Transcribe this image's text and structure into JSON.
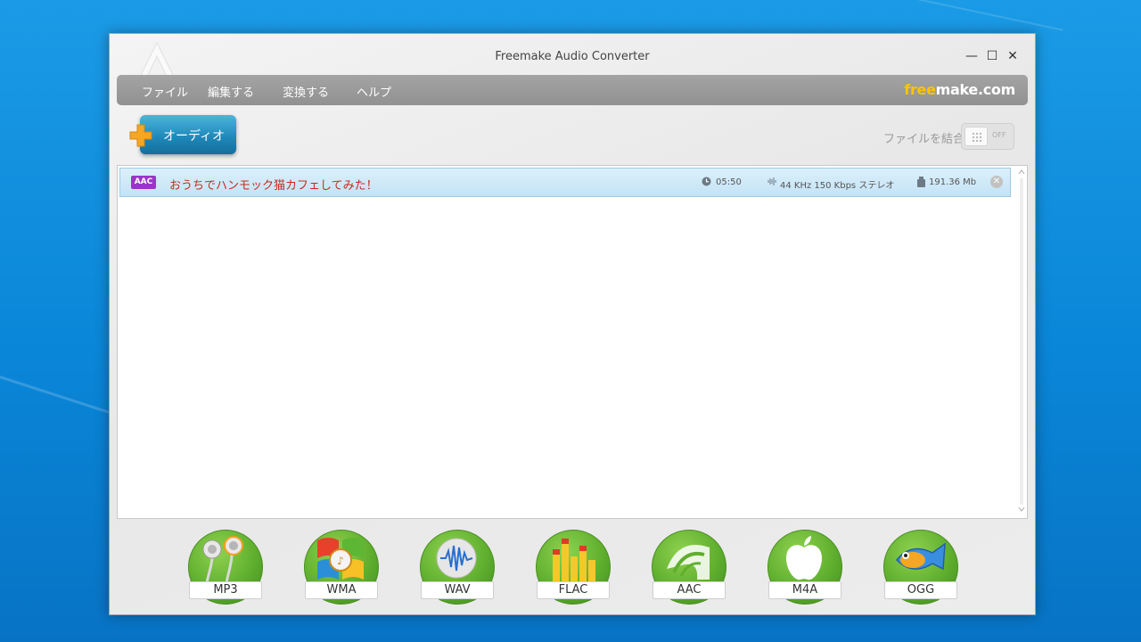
{
  "window": {
    "title": "Freemake Audio Converter",
    "controls": {
      "minimize": "—",
      "maximize": "☐",
      "close": "✕"
    }
  },
  "menu": {
    "items": [
      "ファイル",
      "編集する",
      "変換する",
      "ヘルプ"
    ],
    "brand_free": "free",
    "brand_rest": "make.com"
  },
  "toolbar": {
    "add_audio_label": "オーディオ",
    "join_label": "ファイルを結合",
    "join_state": "OFF"
  },
  "files": [
    {
      "format_badge": "AAC",
      "title": "おうちでハンモック猫カフェしてみた！",
      "duration": "05:50",
      "audio_info": "44 KHz  150 Kbps  ステレオ",
      "size": "191.36 Mb"
    }
  ],
  "formats": [
    "MP3",
    "WMA",
    "WAV",
    "FLAC",
    "AAC",
    "M4A",
    "OGG"
  ],
  "colors": {
    "accent": "#1d86b8",
    "menu_bg": "#9a9a9a",
    "format_green": "#5fae2e",
    "file_title": "#c62b1d",
    "badge_purple": "#9b35c8",
    "brand_yellow": "#ffc400"
  }
}
